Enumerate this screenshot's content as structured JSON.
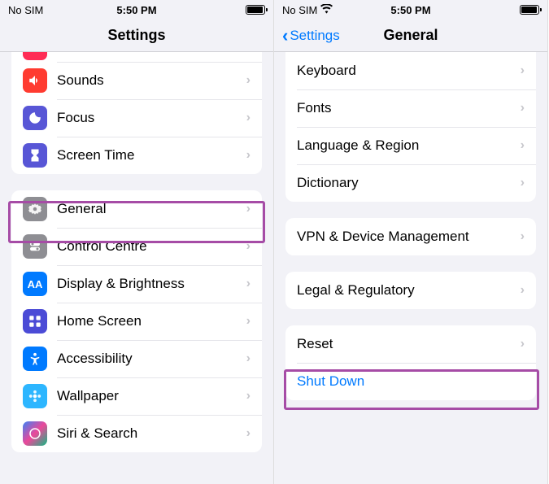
{
  "left": {
    "status": {
      "carrier": "No SIM",
      "time": "5:50 PM"
    },
    "title": "Settings",
    "group1": [
      {
        "key": "sounds",
        "label": "Sounds",
        "icon": "speaker-icon",
        "color": "ic-red"
      },
      {
        "key": "focus",
        "label": "Focus",
        "icon": "moon-icon",
        "color": "ic-purple"
      },
      {
        "key": "screentime",
        "label": "Screen Time",
        "icon": "hourglass-icon",
        "color": "ic-purple2"
      }
    ],
    "group2": [
      {
        "key": "general",
        "label": "General",
        "icon": "gear-icon",
        "color": "ic-gray",
        "highlighted": true
      },
      {
        "key": "controlcentre",
        "label": "Control Centre",
        "icon": "toggles-icon",
        "color": "ic-gray2"
      },
      {
        "key": "display",
        "label": "Display & Brightness",
        "icon": "aa-icon",
        "color": "ic-blue"
      },
      {
        "key": "homescreen",
        "label": "Home Screen",
        "icon": "grid-icon",
        "color": "ic-purple3"
      },
      {
        "key": "accessibility",
        "label": "Accessibility",
        "icon": "person-icon",
        "color": "ic-blue"
      },
      {
        "key": "wallpaper",
        "label": "Wallpaper",
        "icon": "flower-icon",
        "color": "ic-cyan"
      },
      {
        "key": "siri",
        "label": "Siri & Search",
        "icon": "siri-icon",
        "color": "ic-siri"
      }
    ]
  },
  "right": {
    "status": {
      "carrier": "No SIM",
      "time": "5:50 PM"
    },
    "back": "Settings",
    "title": "General",
    "group1": [
      {
        "key": "keyboard",
        "label": "Keyboard"
      },
      {
        "key": "fonts",
        "label": "Fonts"
      },
      {
        "key": "language",
        "label": "Language & Region"
      },
      {
        "key": "dictionary",
        "label": "Dictionary"
      }
    ],
    "group2": [
      {
        "key": "vpn",
        "label": "VPN & Device Management"
      }
    ],
    "group3": [
      {
        "key": "legal",
        "label": "Legal & Regulatory"
      }
    ],
    "group4": [
      {
        "key": "reset",
        "label": "Reset",
        "highlighted": true
      },
      {
        "key": "shutdown",
        "label": "Shut Down",
        "link": true,
        "no_chevron": true
      }
    ]
  }
}
